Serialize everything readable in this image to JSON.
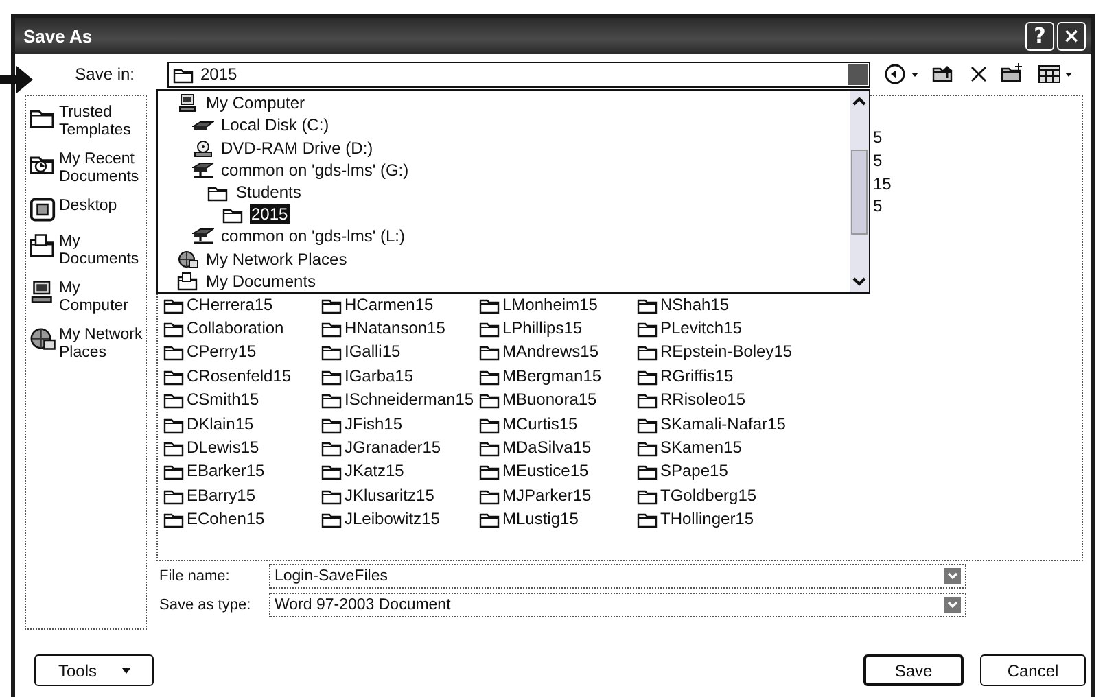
{
  "window": {
    "title": "Save As",
    "help_button": "?",
    "close_button": "×"
  },
  "save_in": {
    "label": "Save in:",
    "value": "2015",
    "expanded": true
  },
  "toolbar": [
    {
      "kind": "back"
    },
    {
      "kind": "up"
    },
    {
      "kind": "delete"
    },
    {
      "kind": "new-folder"
    },
    {
      "kind": "views"
    }
  ],
  "location_tree": [
    {
      "label": "My Computer",
      "kind": "computer",
      "selected": false,
      "children": [
        {
          "label": "Local Disk (C:)",
          "kind": "disk",
          "selected": false
        },
        {
          "label": "DVD-RAM Drive (D:)",
          "kind": "dvd",
          "selected": false
        },
        {
          "label": "common on 'gds-lms' (G:)",
          "kind": "network-drive",
          "selected": false,
          "children": [
            {
              "label": "Students",
              "kind": "folder",
              "selected": false,
              "children": [
                {
                  "label": "2015",
                  "kind": "folder",
                  "selected": true
                }
              ]
            }
          ]
        },
        {
          "label": "common on 'gds-lms' (L:)",
          "kind": "network-drive",
          "selected": false
        }
      ]
    },
    {
      "label": "My Network Places",
      "kind": "network",
      "selected": false
    },
    {
      "label": "My Documents",
      "kind": "documents",
      "selected": false
    }
  ],
  "places": [
    {
      "label": "Trusted Templates",
      "kind": "folder"
    },
    {
      "label": "My Recent Documents",
      "kind": "recent"
    },
    {
      "label": "Desktop",
      "kind": "desktop"
    },
    {
      "label": "My Documents",
      "kind": "documents"
    },
    {
      "label": "My Computer",
      "kind": "computer"
    },
    {
      "label": "My Network Places",
      "kind": "network"
    }
  ],
  "partly_hidden_items": [
    "5",
    "5",
    "15",
    "5"
  ],
  "files": [
    "CHerrera15",
    "Collaboration",
    "CPerry15",
    "CRosenfeld15",
    "CSmith15",
    "DKlain15",
    "DLewis15",
    "EBarker15",
    "EBarry15",
    "ECohen15",
    "HCarmen15",
    "HNatanson15",
    "IGalli15",
    "IGarba15",
    "ISchneiderman15",
    "JFish15",
    "JGranader15",
    "JKatz15",
    "JKlusaritz15",
    "JLeibowitz15",
    "LMonheim15",
    "LPhillips15",
    "MAndrews15",
    "MBergman15",
    "MBuonora15",
    "MCurtis15",
    "MDaSilva15",
    "MEustice15",
    "MJParker15",
    "MLustig15",
    "NShah15",
    "PLevitch15",
    "REpstein-Boley15",
    "RGriffis15",
    "RRisoleo15",
    "SKamali-Nafar15",
    "SKamen15",
    "SPape15",
    "TGoldberg15",
    "THollinger15"
  ],
  "file_name": {
    "label": "File name:",
    "value": "Login-SaveFiles"
  },
  "save_as_type": {
    "label": "Save as type:",
    "value": "Word 97-2003 Document"
  },
  "buttons": [
    {
      "kind": "menu",
      "label": "Tools"
    },
    {
      "kind": "default",
      "label": "Save"
    },
    {
      "kind": "plain",
      "label": "Cancel"
    }
  ]
}
